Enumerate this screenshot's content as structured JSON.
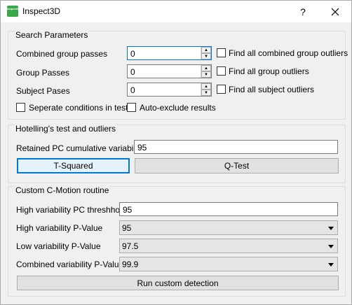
{
  "window": {
    "title": "Inspect3D",
    "icon_text": "Inspect3D",
    "help_label": "?",
    "close_icon": "close-icon"
  },
  "search": {
    "title": "Search Parameters",
    "rows": [
      {
        "label": "Combined group passes",
        "value": "0",
        "check_label": "Find all combined group outliers"
      },
      {
        "label": "Group Passes",
        "value": "0",
        "check_label": "Find all group outliers"
      },
      {
        "label": "Subject Pases",
        "value": "0",
        "check_label": "Find all subject outliers"
      }
    ],
    "separate_label": "Seperate conditions in test",
    "autoexclude_label": "Auto-exclude results"
  },
  "hotelling": {
    "title": "Hotelling's test and outliers",
    "retained_label": "Retained PC cumulative variability",
    "retained_value": "95",
    "tsquared_label": "T-Squared",
    "qtest_label": "Q-Test"
  },
  "cmotion": {
    "title": "Custom C-Motion routine",
    "high_pc_label": "High variability PC threshhold",
    "high_pc_value": "95",
    "high_p_label": "High variability P-Value",
    "high_p_value": "95",
    "low_p_label": "Low variability P-Value",
    "low_p_value": "97.5",
    "combined_p_label": "Combined variability P-Value",
    "combined_p_value": "99.9",
    "run_label": "Run custom detection"
  },
  "colors": {
    "accent": "#0078d7",
    "icon_green": "#3aa84a",
    "background": "#f0f0f0"
  }
}
